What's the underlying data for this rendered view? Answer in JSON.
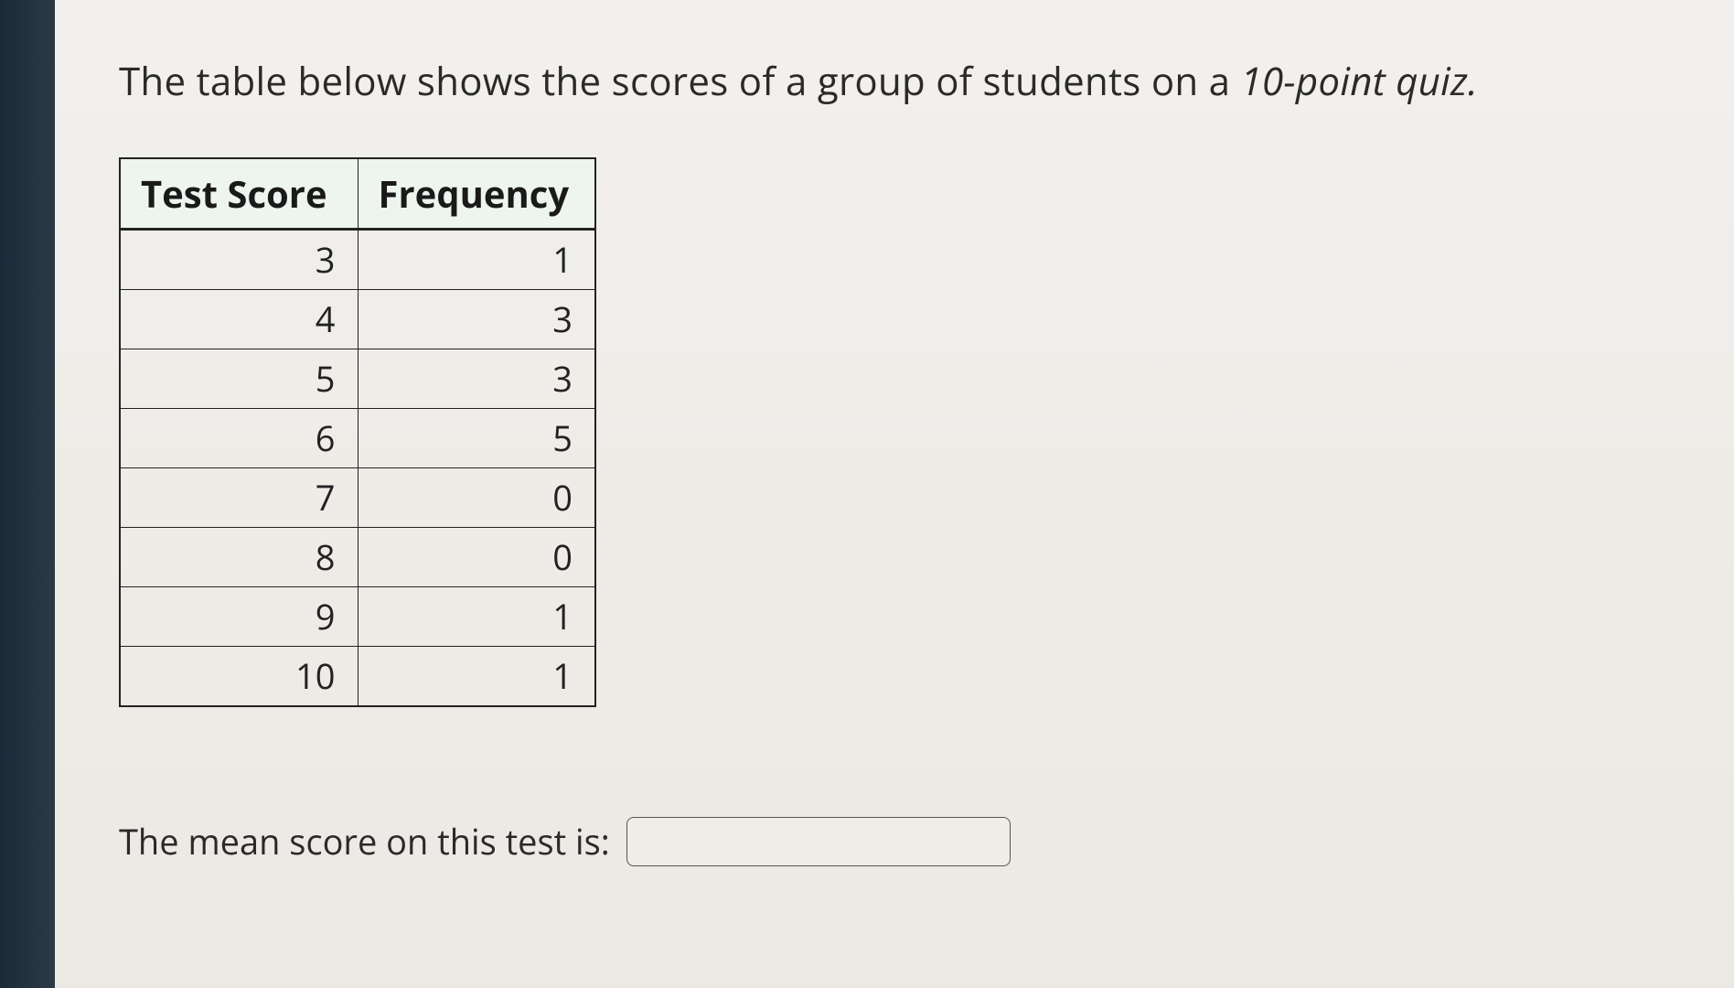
{
  "prompt": {
    "pre_text": "The table below shows the scores of a group of students on a ",
    "italic_text": "10-point quiz.",
    "post_text": ""
  },
  "table": {
    "headers": {
      "col1": "Test Score",
      "col2": "Frequency"
    },
    "rows": [
      {
        "score": "3",
        "freq": "1"
      },
      {
        "score": "4",
        "freq": "3"
      },
      {
        "score": "5",
        "freq": "3"
      },
      {
        "score": "6",
        "freq": "5"
      },
      {
        "score": "7",
        "freq": "0"
      },
      {
        "score": "8",
        "freq": "0"
      },
      {
        "score": "9",
        "freq": "1"
      },
      {
        "score": "10",
        "freq": "1"
      }
    ]
  },
  "answer": {
    "label": "The mean score on this test is:",
    "value": ""
  }
}
